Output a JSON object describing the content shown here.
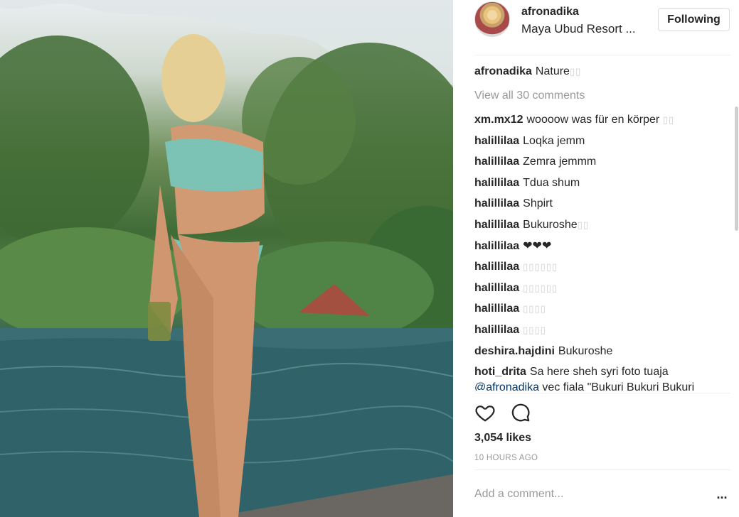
{
  "post": {
    "username": "afronadika",
    "location": "Maya Ubud Resort ...",
    "follow_label": "Following",
    "photo_icon": "photo-image"
  },
  "comments": {
    "caption": {
      "user": "afronadika",
      "text": "Nature",
      "tail": "▯▯"
    },
    "view_all": "View all 30 comments",
    "items": [
      {
        "user": "xm.mx12",
        "text": "woooow was für en körper",
        "tail": "▯▯"
      },
      {
        "user": "halillilaa",
        "text": "Loqka jemm",
        "tail": ""
      },
      {
        "user": "halillilaa",
        "text": "Zemra jemmm",
        "tail": ""
      },
      {
        "user": "halillilaa",
        "text": "Tdua shum",
        "tail": ""
      },
      {
        "user": "halillilaa",
        "text": "Shpirt",
        "tail": ""
      },
      {
        "user": "halillilaa",
        "text": "Bukuroshe",
        "tail": "▯▯"
      },
      {
        "user": "halillilaa",
        "text": "❤❤❤",
        "tail": ""
      },
      {
        "user": "halillilaa",
        "text": "",
        "tail": "▯▯▯▯▯▯"
      },
      {
        "user": "halillilaa",
        "text": "",
        "tail": "▯▯▯▯▯▯"
      },
      {
        "user": "halillilaa",
        "text": "",
        "tail": "▯▯▯▯"
      },
      {
        "user": "halillilaa",
        "text": "",
        "tail": "▯▯▯▯"
      },
      {
        "user": "deshira.hajdini",
        "text": "Bukuroshe",
        "tail": ""
      }
    ],
    "last": {
      "user": "hoti_drita",
      "text": "Sa here sheh syri foto tuaja",
      "mention": "@afronadika",
      "rest": "vec fiala \"Bukuri Bukuri Bukuri"
    }
  },
  "actions": {
    "like_icon": "heart-outline",
    "comment_icon": "speech-bubble",
    "likes": "3,054 likes",
    "time": "10 HOURS AGO"
  },
  "add_comment": {
    "placeholder": "Add a comment...",
    "more_label": "..."
  }
}
